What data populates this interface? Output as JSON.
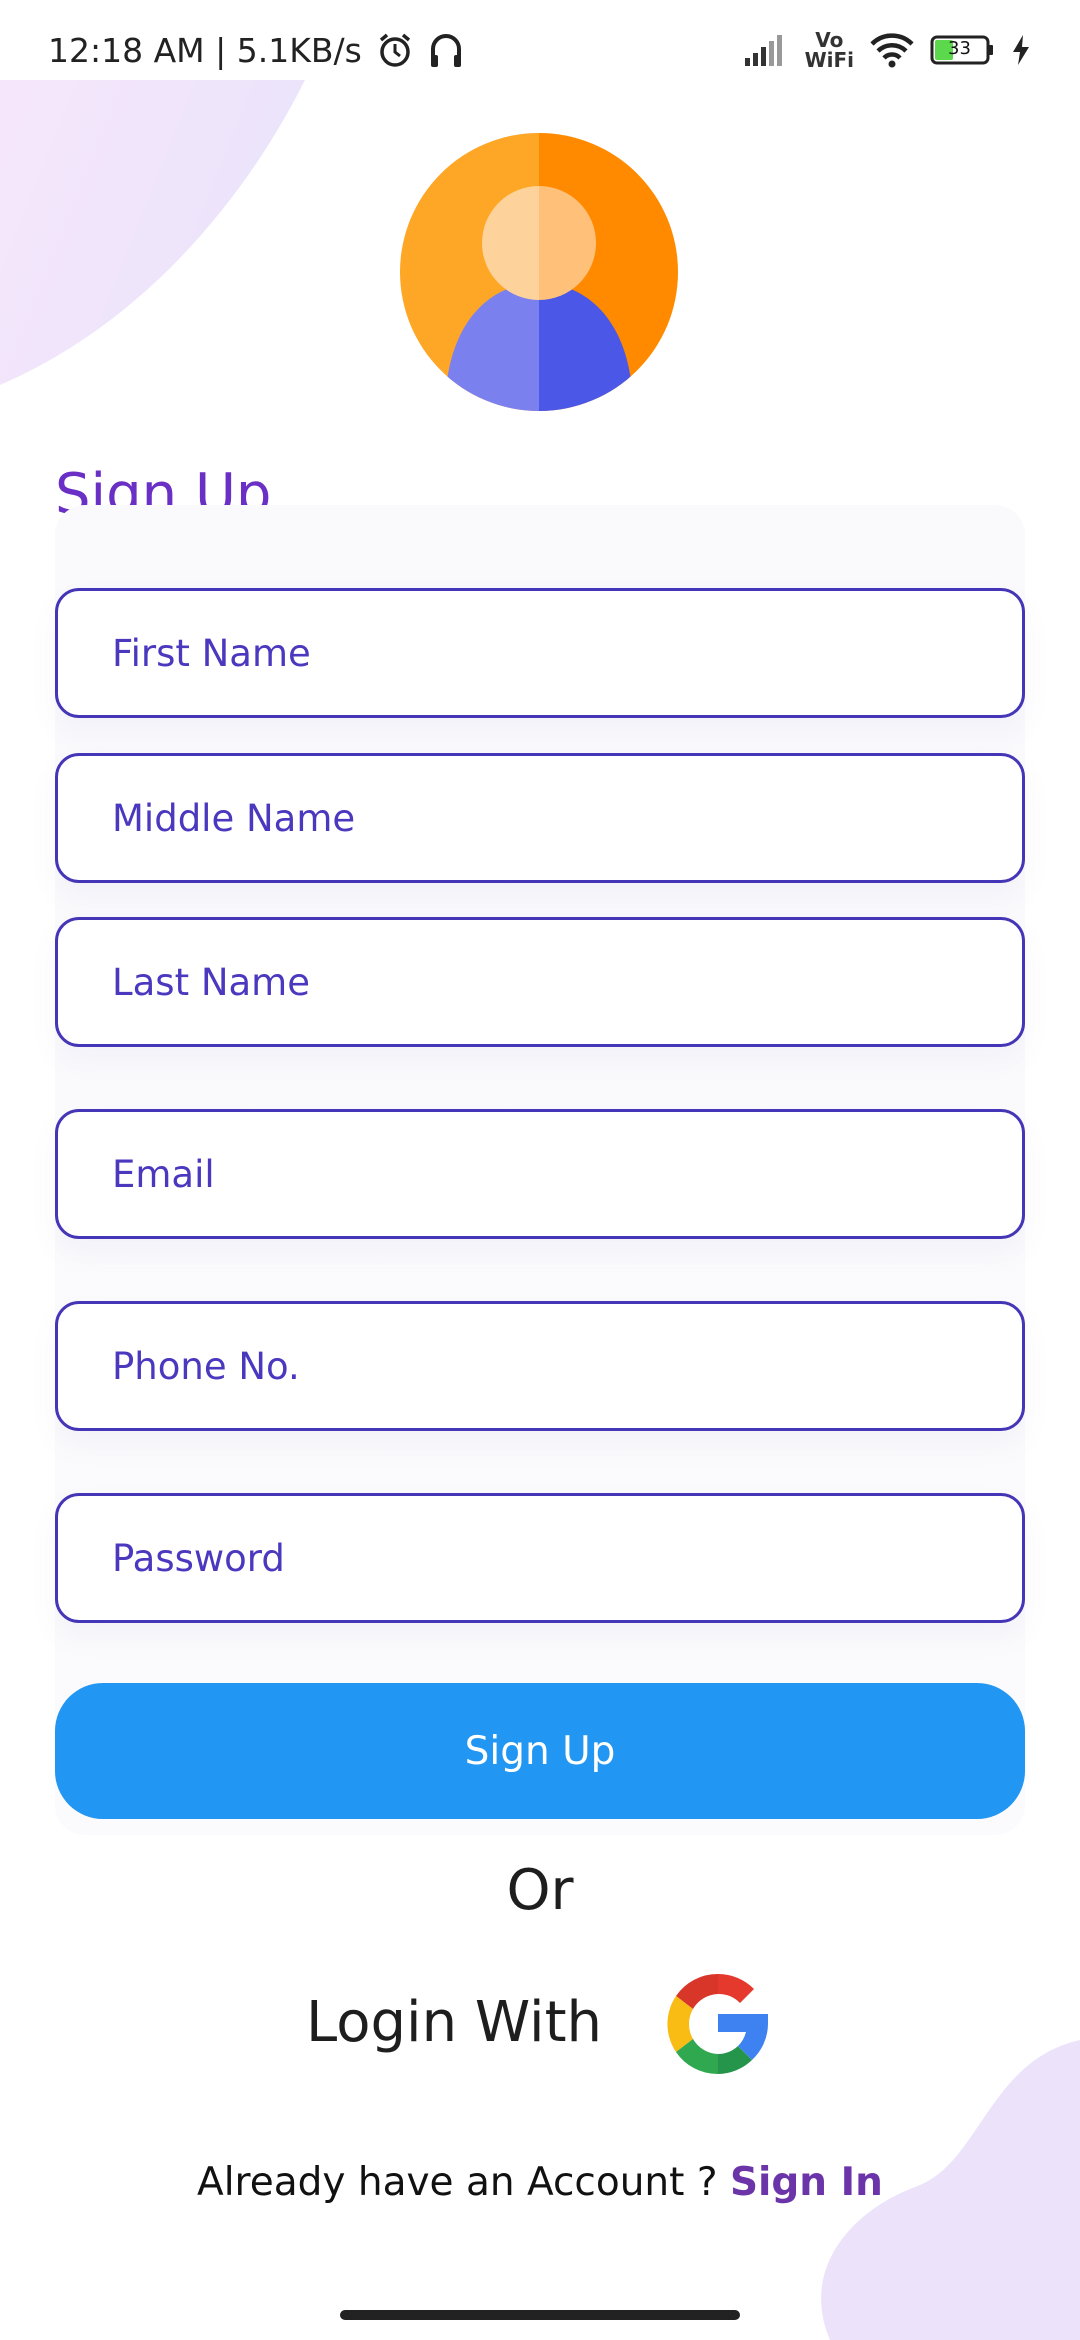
{
  "status_bar": {
    "time": "12:18 AM | 5.1KB/s",
    "vowifi_top": "Vo",
    "vowifi_bottom": "WiFi",
    "battery": "33"
  },
  "title": "Sign Up",
  "fields": {
    "first_name": "First Name",
    "middle_name": "Middle Name",
    "last_name": "Last Name",
    "email": "Email",
    "phone": "Phone No.",
    "password": "Password"
  },
  "signup_button": "Sign Up",
  "or_text": "Or",
  "login_with": "Login With",
  "footer": {
    "prompt": "Already have an Account ?",
    "link": "Sign In"
  },
  "colors": {
    "accent": "#4536b8",
    "title": "#6a2fc4",
    "button": "#2196f2",
    "link": "#6b34a8"
  },
  "icons": [
    "alarm-icon",
    "headphones-icon",
    "signal-icon",
    "wifi-icon",
    "battery-icon",
    "charging-icon",
    "avatar-icon",
    "google-icon"
  ]
}
